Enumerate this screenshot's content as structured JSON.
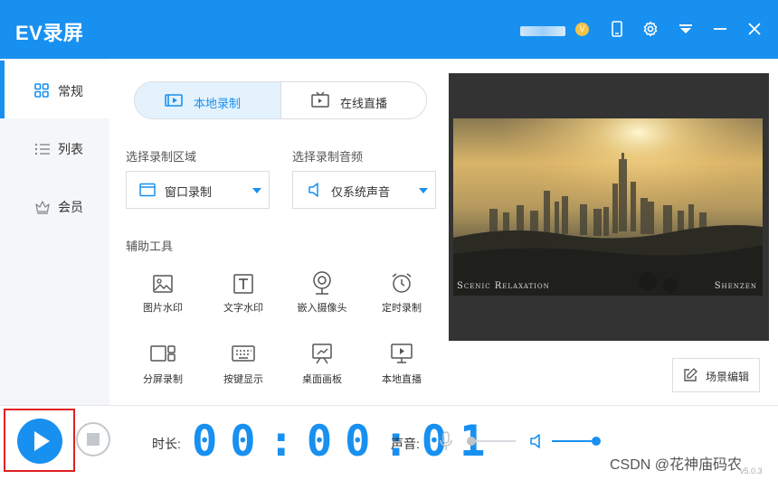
{
  "app": {
    "title": "EV录屏",
    "vip_badge": "V"
  },
  "window_controls": [
    "phone-icon",
    "gear-icon",
    "dropdown-icon",
    "minimize-icon",
    "close-icon"
  ],
  "sidebar": {
    "items": [
      {
        "label": "常规",
        "icon": "grid-icon",
        "active": true
      },
      {
        "label": "列表",
        "icon": "list-icon",
        "active": false
      },
      {
        "label": "会员",
        "icon": "crown-icon",
        "active": false
      }
    ]
  },
  "tabs": [
    {
      "label": "本地录制",
      "icon": "record-icon",
      "active": true
    },
    {
      "label": "在线直播",
      "icon": "tv-icon",
      "active": false
    }
  ],
  "area": {
    "label": "选择录制区域",
    "value": "窗口录制"
  },
  "audio": {
    "label": "选择录制音频",
    "value": "仅系统声音"
  },
  "tools": {
    "label": "辅助工具",
    "items": [
      {
        "label": "图片水印",
        "icon": "image-icon"
      },
      {
        "label": "文字水印",
        "icon": "text-icon"
      },
      {
        "label": "嵌入摄像头",
        "icon": "camera-icon"
      },
      {
        "label": "定时录制",
        "icon": "alarm-icon"
      },
      {
        "label": "分屏录制",
        "icon": "split-screen-icon"
      },
      {
        "label": "按键显示",
        "icon": "keyboard-icon"
      },
      {
        "label": "桌面画板",
        "icon": "easel-icon"
      },
      {
        "label": "本地直播",
        "icon": "monitor-play-icon"
      }
    ]
  },
  "preview": {
    "caption_left": "Scenic Relaxation",
    "caption_right": "Shenzen"
  },
  "scene_button": {
    "label": "场景编辑"
  },
  "bottom": {
    "duration_label": "时长:",
    "timer": "00:00:01",
    "volume_label": "声音:",
    "mic_level": 0.0,
    "speaker_level": 1.0
  },
  "watermark": "CSDN @花神庙码农",
  "version": "v5.0.3",
  "colors": {
    "accent": "#1890f0",
    "highlight_border": "#e02020",
    "sidebar_bg": "#f4f6f9"
  }
}
